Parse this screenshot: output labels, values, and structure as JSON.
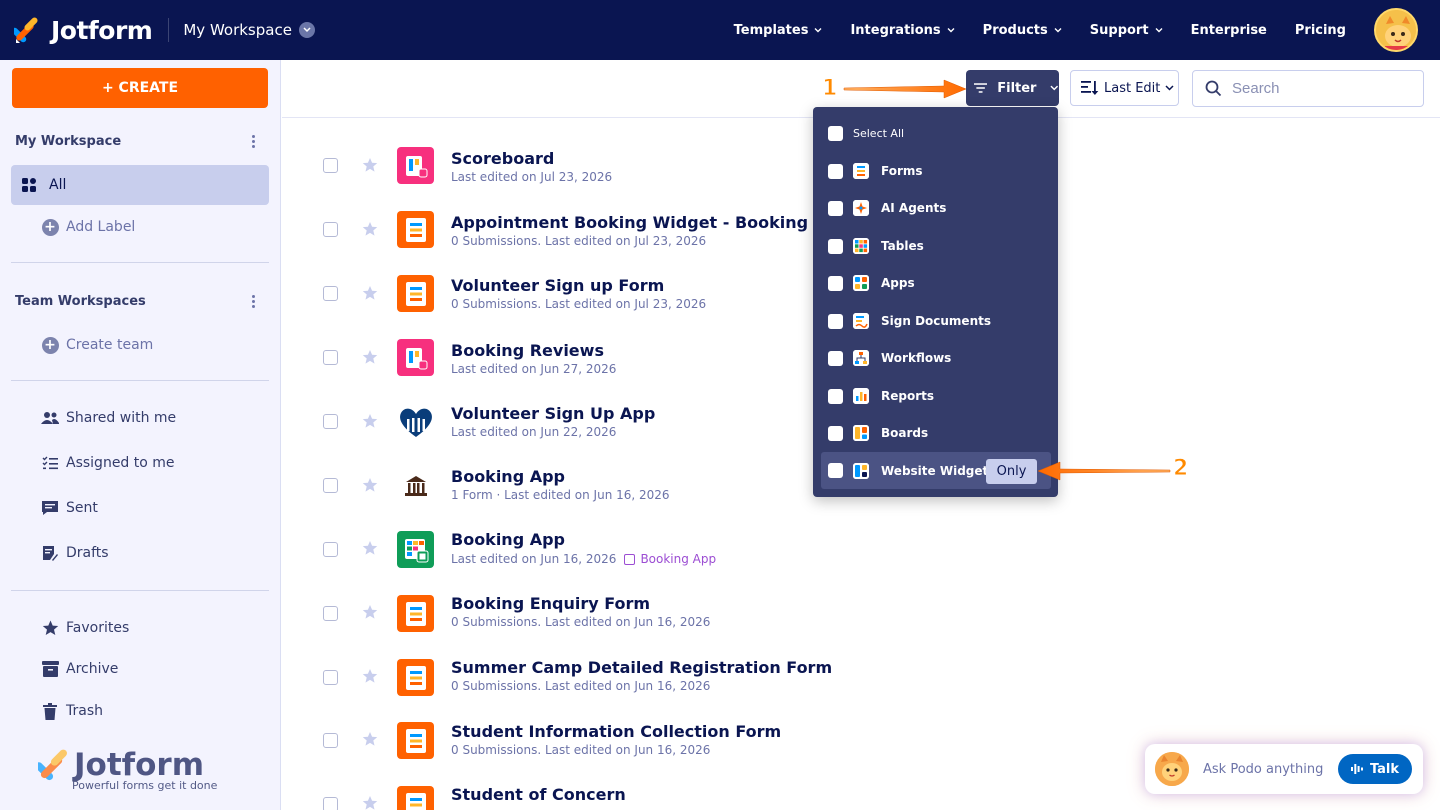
{
  "brand": {
    "name": "Jotform",
    "tagline": "Powerful forms get it done"
  },
  "nav": {
    "workspace": "My Workspace",
    "links": [
      {
        "label": "Templates",
        "dropdown": true
      },
      {
        "label": "Integrations",
        "dropdown": true
      },
      {
        "label": "Products",
        "dropdown": true
      },
      {
        "label": "Support",
        "dropdown": true
      },
      {
        "label": "Enterprise",
        "dropdown": false
      },
      {
        "label": "Pricing",
        "dropdown": false
      }
    ]
  },
  "sidebar": {
    "create_label": "+ CREATE",
    "my_workspace_title": "My Workspace",
    "all_label": "All",
    "add_label": "Add Label",
    "team_title": "Team Workspaces",
    "create_team": "Create team",
    "items": [
      {
        "label": "Shared with me",
        "icon": "users-icon"
      },
      {
        "label": "Assigned to me",
        "icon": "checklist-icon"
      },
      {
        "label": "Sent",
        "icon": "message-icon"
      },
      {
        "label": "Drafts",
        "icon": "draft-icon"
      }
    ],
    "bottom_items": [
      {
        "label": "Favorites",
        "icon": "star-icon"
      },
      {
        "label": "Archive",
        "icon": "archive-icon"
      },
      {
        "label": "Trash",
        "icon": "trash-icon"
      }
    ]
  },
  "toolbar": {
    "filter_label": "Filter",
    "sort_label": "Last Edit",
    "search_placeholder": "Search"
  },
  "filter_menu": {
    "select_all": "Select All",
    "items": [
      {
        "label": "Forms",
        "icon": "form-icon"
      },
      {
        "label": "AI Agents",
        "icon": "ai-agent-icon"
      },
      {
        "label": "Tables",
        "icon": "table-icon"
      },
      {
        "label": "Apps",
        "icon": "app-icon"
      },
      {
        "label": "Sign Documents",
        "icon": "sign-icon"
      },
      {
        "label": "Workflows",
        "icon": "workflow-icon"
      },
      {
        "label": "Reports",
        "icon": "report-icon"
      },
      {
        "label": "Boards",
        "icon": "board-icon"
      },
      {
        "label": "Website Widgets",
        "icon": "widget-icon",
        "highlighted": true
      }
    ],
    "only_label": "Only"
  },
  "annotations": {
    "one": "1",
    "two": "2"
  },
  "list": [
    {
      "title": "Scoreboard",
      "sub": "Last edited on Jul 23, 2026",
      "type": "board"
    },
    {
      "title": "Appointment Booking Widget - Booking Form",
      "sub": "0 Submissions. Last edited on Jul 23, 2026",
      "type": "form"
    },
    {
      "title": "Volunteer Sign up Form",
      "sub": "0 Submissions. Last edited on Jul 23, 2026",
      "type": "form"
    },
    {
      "title": "Booking Reviews",
      "sub": "Last edited on Jun 27, 2026",
      "type": "board"
    },
    {
      "title": "Volunteer Sign Up App",
      "sub": "Last edited on Jun 22, 2026",
      "type": "heart-app"
    },
    {
      "title": "Booking App",
      "sub": "1 Form · Last edited on Jun 16, 2026",
      "type": "building-app"
    },
    {
      "title": "Booking App",
      "sub": "Last edited on Jun 16, 2026",
      "type": "table",
      "tag": "Booking App"
    },
    {
      "title": "Booking Enquiry Form",
      "sub": "0 Submissions. Last edited on Jun 16, 2026",
      "type": "form"
    },
    {
      "title": "Summer Camp Detailed Registration Form",
      "sub": "0 Submissions. Last edited on Jun 16, 2026",
      "type": "form"
    },
    {
      "title": "Student Information Collection Form",
      "sub": "0 Submissions. Last edited on Jun 16, 2026",
      "type": "form"
    },
    {
      "title": "Student of Concern",
      "sub": "",
      "type": "form"
    }
  ],
  "podo": {
    "placeholder": "Ask Podo anything",
    "talk": "Talk"
  },
  "colors": {
    "navy": "#0a1551",
    "orange": "#ff6100",
    "menu": "#343c6a"
  }
}
